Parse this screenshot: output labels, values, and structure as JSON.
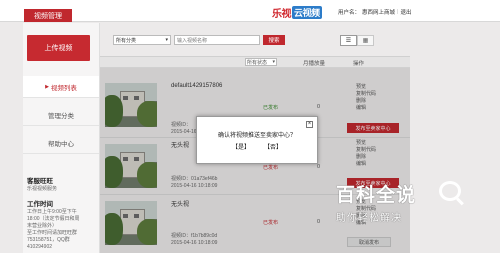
{
  "header": {
    "tab_title": "视频管理",
    "logo_part1": "乐视",
    "logo_part2": "云视频",
    "user_label": "用户名：",
    "user_name": "惠西网上商城",
    "divider": "|",
    "logout": "退出"
  },
  "sidebar": {
    "upload_label": "上传视频",
    "items": [
      {
        "label": "视频列表",
        "active": true,
        "arrow": "▶"
      },
      {
        "label": "管理分类",
        "active": false
      },
      {
        "label": "帮助中心",
        "active": false
      }
    ],
    "service": {
      "title": "客服旺旺",
      "lines": [
        "乐视视频服务"
      ]
    },
    "hours": {
      "title": "工作时间",
      "lines": [
        "工作日上午9:00至下午",
        "18:00（法定节假日和周",
        "末营业除外）",
        "至工作时间请加旺旺群",
        "753158751，QQ群",
        "410294902"
      ]
    }
  },
  "filters": {
    "category_select": "所有分类",
    "search_placeholder": "输入视频名称",
    "search_button": "搜索",
    "view_list_icon": "list-icon",
    "view_grid_icon": "grid-icon",
    "list_glyph": "☰",
    "grid_glyph": "▦"
  },
  "table": {
    "status_select": "所有状态",
    "col_status_arrow": "▾",
    "col_plays": "月播放量",
    "col_actions": "操作"
  },
  "rows": [
    {
      "title": "default1429157806",
      "video_id_label": "视频ID：",
      "video_id": "",
      "date": "2015-04-16",
      "status": "已发布",
      "plays": "0",
      "actions": [
        "预览",
        "复制代码",
        "删除",
        "编辑"
      ],
      "publish_button": "发布至卖家中心"
    },
    {
      "title": "无头视",
      "video_id_label": "视频ID：",
      "video_id": "01a73ef46b",
      "date": "2015-04-16 10:18:09",
      "status": "已发布",
      "plays": "0",
      "actions": [
        "预览",
        "复制代码",
        "删除",
        "编辑"
      ],
      "publish_button": "发布至卖家中心"
    },
    {
      "title": "无头视",
      "video_id_label": "视频ID：",
      "video_id": "f1b7b89c0d",
      "date": "2015-04-16 10:18:09",
      "status": "已发布",
      "plays": "0",
      "actions": [
        "预览",
        "复制代码",
        "删除",
        "编辑"
      ],
      "cancel_button": "取消发布"
    }
  ],
  "dialog": {
    "message": "确认将视频推送至卖家中心？",
    "confirm": "【是】",
    "cancel": "【否】",
    "close_glyph": "×"
  },
  "watermark": {
    "big": "百科全说",
    "small": "助你轻松解决"
  },
  "colors": {
    "accent": "#c0282e",
    "logo_blue": "#2c7cc9"
  }
}
